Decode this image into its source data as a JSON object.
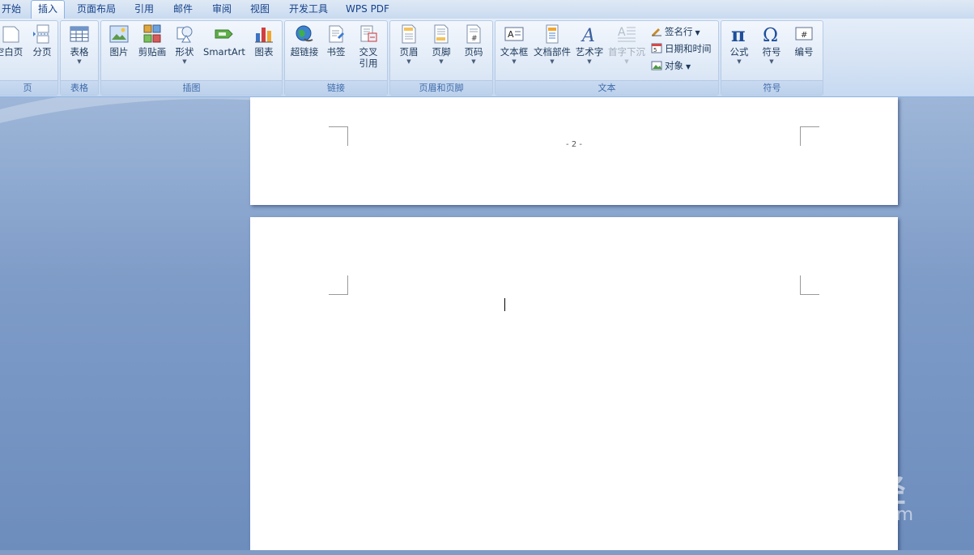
{
  "tabs": [
    {
      "label": "开始",
      "active": false
    },
    {
      "label": "插入",
      "active": true
    },
    {
      "label": "页面布局",
      "active": false
    },
    {
      "label": "引用",
      "active": false
    },
    {
      "label": "邮件",
      "active": false
    },
    {
      "label": "审阅",
      "active": false
    },
    {
      "label": "视图",
      "active": false
    },
    {
      "label": "开发工具",
      "active": false
    },
    {
      "label": "WPS PDF",
      "active": false
    }
  ],
  "ribbon": {
    "pages": {
      "label": "页",
      "blank_page": "空白页",
      "page_break": "分页"
    },
    "tables": {
      "label": "表格",
      "table": "表格"
    },
    "illustrations": {
      "label": "插图",
      "picture": "图片",
      "clip_art": "剪贴画",
      "shapes": "形状",
      "smartart": "SmartArt",
      "chart": "图表"
    },
    "links": {
      "label": "链接",
      "hyperlink": "超链接",
      "bookmark": "书签",
      "cross_ref_1": "交叉",
      "cross_ref_2": "引用"
    },
    "header_footer": {
      "label": "页眉和页脚",
      "header": "页眉",
      "footer": "页脚",
      "page_number": "页码"
    },
    "text": {
      "label": "文本",
      "text_box": "文本框",
      "quick_parts": "文档部件",
      "wordart": "艺术字",
      "drop_cap": "首字下沉",
      "signature_line": "签名行",
      "date_time": "日期和时间",
      "object": "对象"
    },
    "symbols": {
      "label": "符号",
      "equation": "公式",
      "symbol": "符号",
      "number": "编号"
    }
  },
  "document": {
    "page_number_text": "- 2 -"
  },
  "watermark": {
    "main": "Bai du 经验",
    "sub": "jingyan.baidu.com"
  },
  "colors": {
    "accent": "#15428b",
    "ribbon_bg": "#dfe9f5",
    "workspace_bg": "#7f9cc6"
  }
}
